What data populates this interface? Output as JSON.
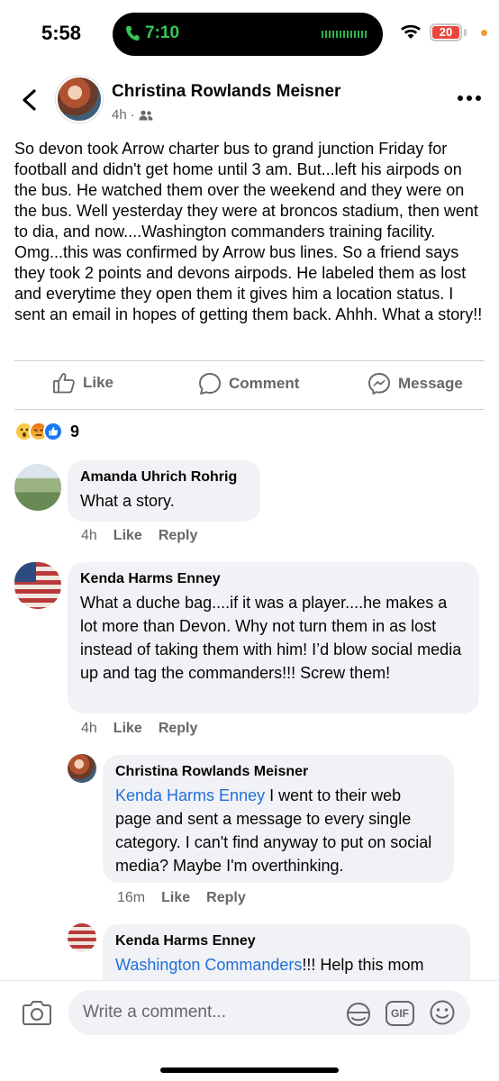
{
  "status_bar": {
    "time": "5:58",
    "call_timer": "7:10",
    "battery_level": "20",
    "battery_color": "#e8473d"
  },
  "post": {
    "author": "Christina Rowlands Meisner",
    "time_ago": "4h",
    "separator": "·",
    "audience_icon": "friends-icon",
    "body": "So devon took Arrow charter bus to grand junction Friday for football and didn't get home until 3 am.  But...left his airpods on the bus.  He watched them over the weekend and they were on the bus.  Well yesterday they were at broncos stadium, then went to dia, and now....Washington commanders training facility.  Omg...this was confirmed by Arrow bus lines.  So a friend says they took 2 points and devons airpods.  He labeled them as lost and everytime they open them it gives him a location status.  I sent an email in hopes of getting them back.  Ahhh.  What a story!!"
  },
  "actions": {
    "like": "Like",
    "comment": "Comment",
    "message": "Message"
  },
  "reactions": {
    "count": "9",
    "types": [
      "wow",
      "angry",
      "like"
    ]
  },
  "comments": [
    {
      "name": "Amanda Uhrich Rohrig",
      "text": "What a story.",
      "time": "4h",
      "like": "Like",
      "reply": "Reply"
    },
    {
      "name": "Kenda Harms Enney",
      "text": "What a duche bag....if it was a player....he makes a lot more than Devon. Why not turn them in as lost instead of taking them with him!  I’d blow social media up and tag the commanders!!! Screw them!",
      "time": "4h",
      "like": "Like",
      "reply": "Reply"
    }
  ],
  "replies": [
    {
      "name": "Christina Rowlands Meisner",
      "mention": "Kenda Harms Enney",
      "text": " I went to their web page and sent a message to every single category.   I can't find anyway to put on social media?  Maybe I'm overthinking.",
      "time": "16m",
      "like": "Like",
      "reply": "Reply"
    },
    {
      "name": "Kenda Harms Enney",
      "mention": "Washington Commanders",
      "text": "!!! Help this mom"
    }
  ],
  "composer": {
    "placeholder": "Write a comment...",
    "gif_label": "GIF"
  },
  "colors": {
    "accent": "#1877f2",
    "mention": "#216fdb",
    "secondary_text": "#65676b",
    "bubble": "#f0f2f5"
  }
}
